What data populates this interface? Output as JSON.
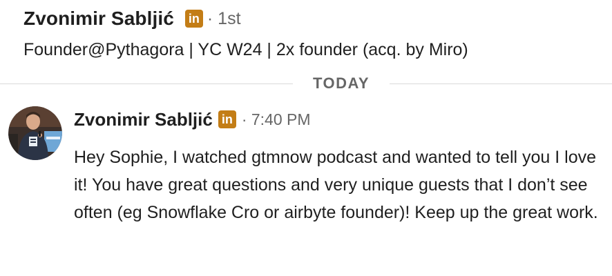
{
  "profile": {
    "name": "Zvonimir Sabljić",
    "badge": "in",
    "degree": "· 1st",
    "headline": "Founder@Pythagora | YC W24 | 2x founder (acq. by Miro)"
  },
  "divider": {
    "label": "TODAY"
  },
  "message": {
    "sender": "Zvonimir Sabljić",
    "badge": "in",
    "time": "· 7:40 PM",
    "body": "Hey Sophie, I watched gtmnow podcast and wanted to tell you I love it! You have great questions and very unique guests that I don’t see often (eg Snowflake Cro or airbyte founder)! Keep up the great work."
  },
  "colors": {
    "badge": "#c37d16",
    "text": "#1f1f1f",
    "muted": "#666666",
    "divider": "#d9d9d9"
  },
  "icons": {
    "premium_badge": "linkedin-premium-icon",
    "avatar": "profile-photo"
  }
}
